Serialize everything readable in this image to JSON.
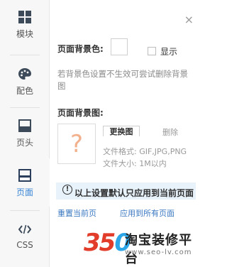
{
  "sidebar": {
    "items": [
      {
        "label": "模块",
        "icon": "grid-icon"
      },
      {
        "label": "配色",
        "icon": "palette-icon"
      },
      {
        "label": "页头",
        "icon": "page-header-icon"
      },
      {
        "label": "页面",
        "icon": "page-icon",
        "active": true
      },
      {
        "label": "CSS",
        "icon": "code-icon"
      }
    ]
  },
  "panel": {
    "close_label": "×",
    "bg_color_label": "页面背景色:",
    "show_label": "显示",
    "hint": "若背景色设置不生效可尝试删除背景图",
    "bg_image_label": "页面背景图:",
    "placeholder_glyph": "?",
    "replace_button": "更换图",
    "delete_button": "删除",
    "file_format": "文件格式: GIF,JPG,PNG",
    "file_size": "文件大小: 1M以内",
    "info_icon": "!",
    "info_text": "以上设置默认只应用到当前页面",
    "reset_link": "重置当前页",
    "apply_all_link": "应用到所有页面"
  },
  "watermark": {
    "num_a": "3",
    "num_b": "5",
    "num_c": "0",
    "brand": "淘宝装修平台",
    "url": "www.seo-lv.com"
  },
  "colors": {
    "accent": "#1e8ce6",
    "link": "#3a78c2",
    "info_bg": "#e8f2fb",
    "placeholder": "#f3b08c"
  }
}
